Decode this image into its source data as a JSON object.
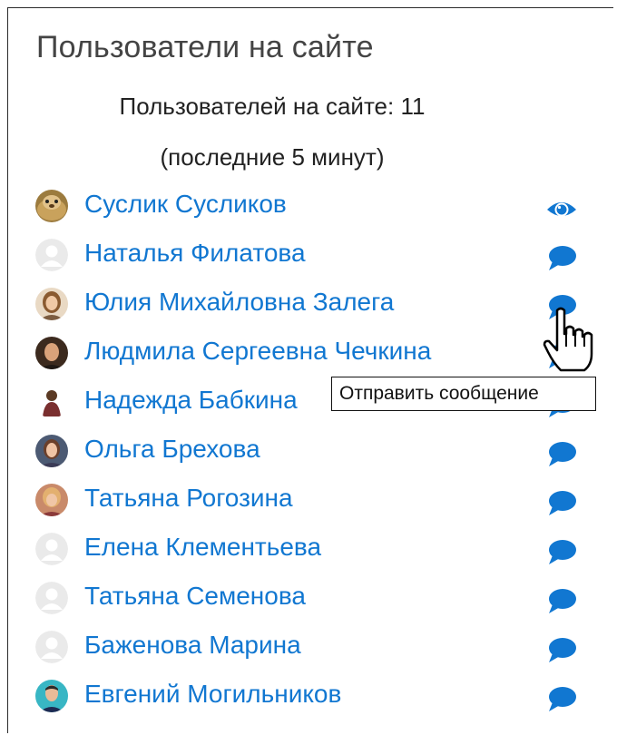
{
  "block": {
    "title": "Пользователи на сайте",
    "summary_line1": "Пользователей на сайте: 11",
    "summary_line2": "(последние 5 минут)"
  },
  "colors": {
    "link": "#1177d1",
    "icon": "#1177d1",
    "title": "#444444"
  },
  "users": [
    {
      "name": "Суслик Сусликов",
      "avatar": "gopher-photo",
      "action": "eye-icon"
    },
    {
      "name": "Наталья Филатова",
      "avatar": "default-user-icon",
      "action": "message-icon"
    },
    {
      "name": "Юлия Михайловна Залега",
      "avatar": "user-photo",
      "action": "message-icon"
    },
    {
      "name": "Людмила Сергеевна Чечкина",
      "avatar": "user-photo",
      "action": "message-icon"
    },
    {
      "name": "Надежда Бабкина",
      "avatar": "user-photo",
      "action": "message-icon"
    },
    {
      "name": "Ольга Брехова",
      "avatar": "user-photo",
      "action": "message-icon"
    },
    {
      "name": "Татьяна Рогозина",
      "avatar": "user-photo",
      "action": "message-icon"
    },
    {
      "name": "Елена Клементьева",
      "avatar": "default-user-icon",
      "action": "message-icon"
    },
    {
      "name": "Татьяна Семенова",
      "avatar": "default-user-icon",
      "action": "message-icon"
    },
    {
      "name": "Баженова Марина",
      "avatar": "default-user-icon",
      "action": "message-icon"
    },
    {
      "name": "Евгений Могильников",
      "avatar": "user-photo",
      "action": "message-icon"
    }
  ],
  "tooltip": {
    "text": "Отправить сообщение"
  },
  "cursor": {
    "icon": "hand-pointer-icon"
  }
}
